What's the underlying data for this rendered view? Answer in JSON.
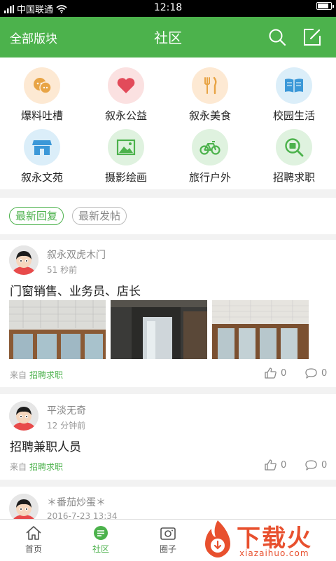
{
  "status_bar": {
    "carrier": "中国联通",
    "time": "12:18",
    "battery_level": 0.85
  },
  "header": {
    "left_label": "全部版块",
    "title": "社区"
  },
  "categories": [
    {
      "label": "爆料吐槽",
      "icon": "gossip-face-icon",
      "bg": "#fde9d3",
      "color": "#e8a445"
    },
    {
      "label": "叙永公益",
      "icon": "heart-icon",
      "bg": "#fbe1e1",
      "color": "#e24b5a"
    },
    {
      "label": "叙永美食",
      "icon": "fork-knife-icon",
      "bg": "#fde9d3",
      "color": "#e8a445"
    },
    {
      "label": "校园生活",
      "icon": "book-icon",
      "bg": "#dbeef9",
      "color": "#3b98d8"
    },
    {
      "label": "叙永文苑",
      "icon": "store-icon",
      "bg": "#dbeef9",
      "color": "#3b98d8"
    },
    {
      "label": "摄影绘画",
      "icon": "picture-icon",
      "bg": "#dff2df",
      "color": "#4cb24c"
    },
    {
      "label": "旅行户外",
      "icon": "bicycle-icon",
      "bg": "#dff2df",
      "color": "#4cb24c"
    },
    {
      "label": "招聘求职",
      "icon": "job-search-icon",
      "bg": "#dff2df",
      "color": "#4cb24c"
    }
  ],
  "filters": {
    "latest_reply": "最新回复",
    "latest_post": "最新发帖"
  },
  "posts": [
    {
      "author": "叙永双虎木门",
      "time": "51 秒前",
      "title": "门窗销售、业务员、店长",
      "from_label": "来自",
      "from_tag": "招聘求职",
      "likes": "0",
      "comments": "0"
    },
    {
      "author": "平淡无奇",
      "time": "12 分钟前",
      "title": "招聘兼职人员",
      "from_label": "来自",
      "from_tag": "招聘求职",
      "likes": "0",
      "comments": "0"
    },
    {
      "author": "＊番茄炒蛋＊",
      "time": "2016-7-23 13:34"
    }
  ],
  "bottom_nav": {
    "home": "首页",
    "community": "社区",
    "circle": "圈子"
  },
  "watermark": {
    "text": "下载火",
    "sub": "xiazaihuo.com"
  },
  "colors": {
    "accent": "#4cb24c",
    "watermark": "#e8502e"
  }
}
